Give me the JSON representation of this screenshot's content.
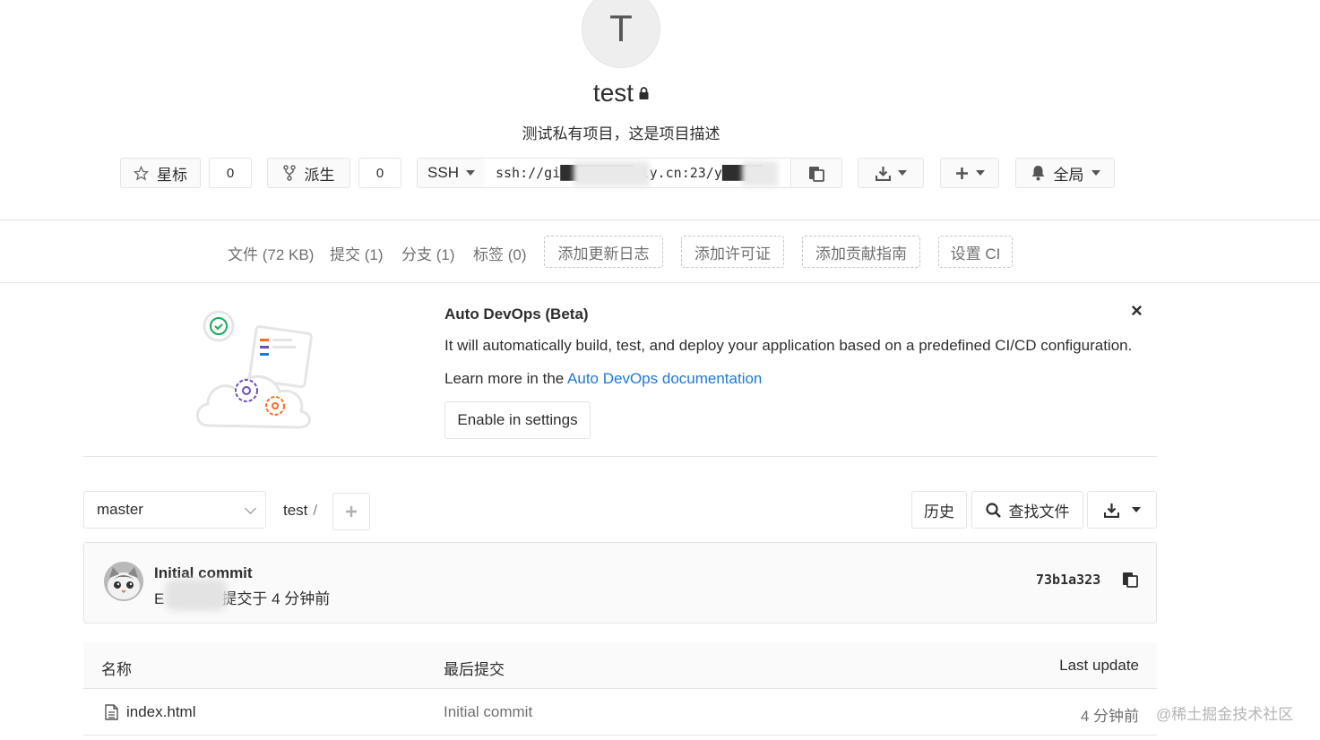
{
  "project": {
    "avatar_letter": "T",
    "name": "test",
    "description": "测试私有项目，这是项目描述"
  },
  "actions": {
    "star_label": "星标",
    "star_count": "0",
    "fork_label": "派生",
    "fork_count": "0",
    "clone_protocol": "SSH",
    "clone_url": "ssh://gi█████████ily.cn:23/y█████·",
    "notification_label": "全局"
  },
  "stats": {
    "files": "文件 (72 KB)",
    "commits": "提交 (1)",
    "branches": "分支 (1)",
    "tags": "标签 (0)",
    "add_changelog": "添加更新日志",
    "add_license": "添加许可证",
    "add_contributing": "添加贡献指南",
    "setup_ci": "设置 CI"
  },
  "devops": {
    "title": "Auto DevOps (Beta)",
    "text": "It will automatically build, test, and deploy your application based on a predefined CI/CD configuration.",
    "learn_prefix": "Learn more in the ",
    "learn_link": "Auto DevOps documentation",
    "enable_button": "Enable in settings",
    "close": "×"
  },
  "tree": {
    "branch": "master",
    "path": "test",
    "path_sep": "/",
    "history_button": "历史",
    "find_file_button": "查找文件"
  },
  "last_commit": {
    "title": "Initial commit",
    "meta": "提交于 4 分钟前",
    "author_initial": "E",
    "sha": "73b1a323"
  },
  "file_table": {
    "headers": {
      "name": "名称",
      "last_commit": "最后提交",
      "last_update": "Last update"
    },
    "rows": [
      {
        "name": "index.html",
        "commit": "Initial commit",
        "updated": "4 分钟前"
      }
    ]
  },
  "watermark": "@稀土掘金技术社区",
  "colors": {
    "link": "#1f78d1",
    "border": "#e5e5e5",
    "muted": "#707070"
  }
}
